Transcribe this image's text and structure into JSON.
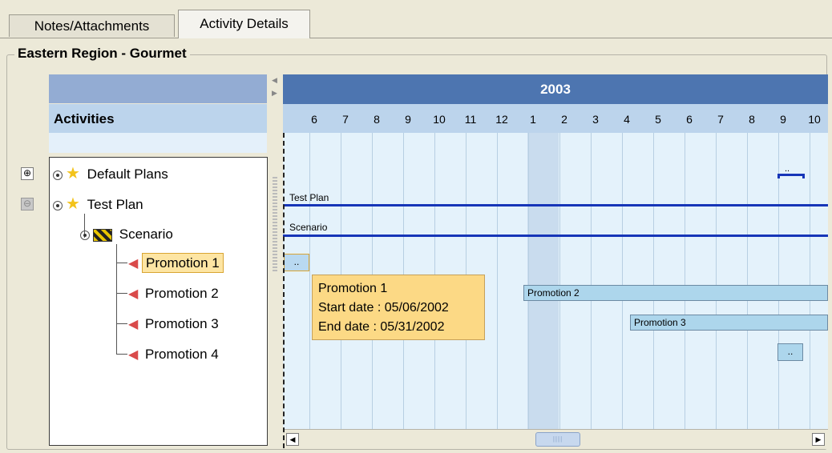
{
  "tabs": [
    {
      "label": "Notes/Attachments"
    },
    {
      "label": "Activity Details"
    }
  ],
  "group_title": "Eastern Region - Gourmet",
  "activities_header": "Activities",
  "tree": [
    {
      "label": "Default Plans",
      "icon": "star-icon"
    },
    {
      "label": "Test Plan",
      "icon": "star-icon"
    },
    {
      "label": "Scenario",
      "icon": "clapperboard-icon"
    },
    {
      "label": "Promotion 1",
      "icon": "megaphone-icon",
      "selected": true
    },
    {
      "label": "Promotion 2",
      "icon": "megaphone-icon"
    },
    {
      "label": "Promotion 3",
      "icon": "megaphone-icon"
    },
    {
      "label": "Promotion 4",
      "icon": "megaphone-icon"
    }
  ],
  "gantt": {
    "year": "2003",
    "months": [
      "6",
      "7",
      "8",
      "9",
      "10",
      "11",
      "12",
      "1",
      "2",
      "3",
      "4",
      "5",
      "6",
      "7",
      "8",
      "9",
      "10"
    ],
    "bars": {
      "test_plan": "Test Plan",
      "scenario": "Scenario",
      "promotion2": "Promotion 2",
      "promotion3": "Promotion 3",
      "ellipsis": ".."
    },
    "tooltip": {
      "title": "Promotion 1",
      "start": "Start date : 05/06/2002",
      "end": "End date : 05/31/2002"
    }
  },
  "colors": {
    "year_band": "#4d75b0",
    "month_band": "#bcd4ec",
    "bar_line": "#1635b8",
    "tooltip": "#fcd985",
    "selection": "#fde5a3"
  }
}
